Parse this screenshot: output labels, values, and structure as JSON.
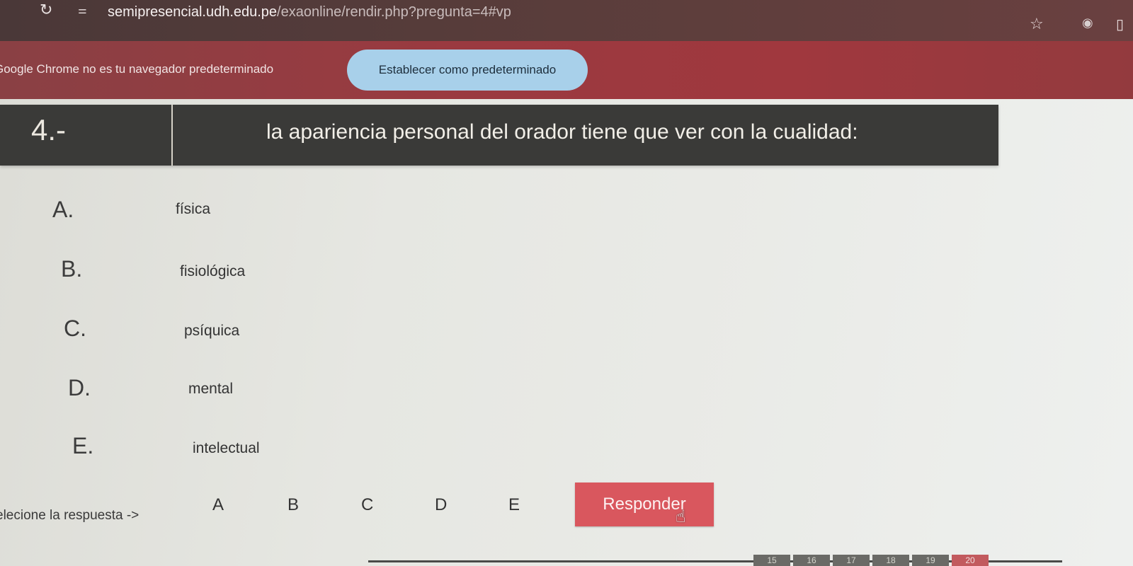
{
  "browser": {
    "url_domain": "semipresencial.udh.edu.pe",
    "url_path": "/exaonline/rendir.php?pregunta=4#vp"
  },
  "infobar": {
    "message": "Google Chrome no es tu navegador predeterminado",
    "button_label": "Establecer como predeterminado"
  },
  "question": {
    "number": "4.-",
    "text": "la apariencia personal del orador tiene que ver con la cualidad:"
  },
  "options": [
    {
      "letter": "A.",
      "text": "física"
    },
    {
      "letter": "B.",
      "text": "fisiológica"
    },
    {
      "letter": "C.",
      "text": "psíquica"
    },
    {
      "letter": "D.",
      "text": "mental"
    },
    {
      "letter": "E.",
      "text": "intelectual"
    }
  ],
  "answer": {
    "label": "elecione la respuesta ->",
    "choices": [
      "A",
      "B",
      "C",
      "D",
      "E"
    ],
    "submit_label": "Responder"
  },
  "page_nav": {
    "pages": [
      "15",
      "16",
      "17",
      "18",
      "19",
      "20"
    ]
  },
  "colors": {
    "topbar": "#4a3838",
    "infobar": "#9a3a40",
    "default_button": "#a8d0ea",
    "question_bar": "#3a3a38",
    "respond_button": "#d9575e"
  }
}
